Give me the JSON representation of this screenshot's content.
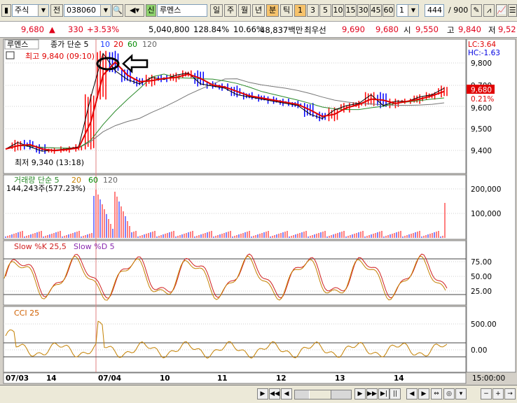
{
  "toolbar": {
    "market": "주식",
    "prev_label": "전",
    "code": "038060",
    "new_badge": "신",
    "stock_name": "루멘스",
    "periods": [
      "일",
      "주",
      "월",
      "년",
      "분",
      "틱"
    ],
    "active_period": "분",
    "intervals": [
      "1",
      "3",
      "5",
      "10",
      "15",
      "30",
      "45",
      "60"
    ],
    "interval_value": "1",
    "count_value": "444",
    "count_total": "/ 900"
  },
  "quote": {
    "price": "9,680",
    "change_arrow": "▲",
    "change": "330",
    "change_pct": "+3.53%",
    "volume": "5,040,800",
    "vol_ratio": "128.84%",
    "turnover": "10.66%",
    "amount": "48,837백만",
    "best_label": "최우선",
    "ask": "9,690",
    "bid": "9,680",
    "open_label": "시",
    "open": "9,550",
    "high_label": "고",
    "high": "9,840",
    "low_label": "저",
    "low": "9,52"
  },
  "chart": {
    "price_panel": {
      "name_tag": "루멘스",
      "ma_label": "종가 단순 5",
      "ma_periods": [
        "10",
        "20",
        "60",
        "120"
      ],
      "high_note": "최고 9,840 (09:10)",
      "low_note": "최저 9,340 (13:18)",
      "lc": "LC:3.64",
      "hc": "HC:-1.63",
      "last_price": "9,680",
      "last_pct": "0.21%",
      "y_ticks": [
        "9,800",
        "9,700",
        "9,600",
        "9,500",
        "9,400"
      ]
    },
    "volume_panel": {
      "title": "거래량 단순 5",
      "ma_periods": [
        "20",
        "60",
        "120"
      ],
      "info": "144,243주(577.23%)",
      "y_ticks": [
        "200,000",
        "100,000"
      ]
    },
    "stoch_panel": {
      "title_k": "Slow %K 25,5",
      "title_d": "Slow %D 5",
      "y_ticks": [
        "75.00",
        "50.00",
        "25.00"
      ]
    },
    "cci_panel": {
      "title": "CCI 25",
      "y_ticks": [
        "500.00",
        "0.00"
      ]
    },
    "x_labels": [
      "07/03",
      "14",
      "07/04",
      "10",
      "11",
      "12",
      "13",
      "14"
    ],
    "time_label": "15:00:00"
  },
  "chart_data": {
    "type": "line",
    "title": "",
    "series": [
      {
        "name": "종가",
        "values": [
          9400,
          9430,
          9410,
          9390,
          9395,
          9400,
          9410,
          9640,
          9840,
          9760,
          9720,
          9700,
          9730,
          9720,
          9740,
          9750,
          9700,
          9690,
          9680,
          9650,
          9640,
          9630,
          9620,
          9610,
          9600,
          9560,
          9540,
          9580,
          9600,
          9610,
          9650,
          9600,
          9620,
          9620,
          9640,
          9650,
          9680
        ]
      }
    ],
    "ylim": [
      9300,
      9880
    ],
    "volume_peak": 200000
  },
  "colors": {
    "up": "#ff0000",
    "down": "#0000ff",
    "ma5": "#e00000",
    "ma20": "#2a8a2a",
    "stoch_k": "#d02020",
    "stoch_d": "#c48000"
  }
}
